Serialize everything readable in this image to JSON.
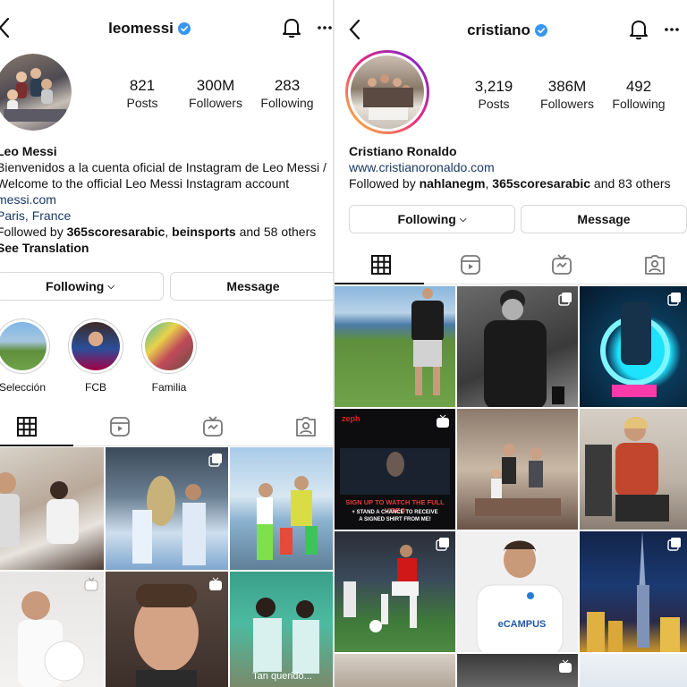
{
  "left": {
    "username": "leomessi",
    "stats": [
      {
        "value": "821",
        "label": "Posts"
      },
      {
        "value": "300M",
        "label": "Followers"
      },
      {
        "value": "283",
        "label": "Following"
      }
    ],
    "bio": {
      "name": "Leo Messi",
      "line1": "Bienvenidos a la cuenta oficial de Instagram de Leo Messi /",
      "line2": "Welcome to the official Leo Messi Instagram account",
      "link": "messi.com",
      "loc_city": "Paris",
      "loc_sep": ", ",
      "loc_country": "France",
      "followed_prefix": "Followed by ",
      "followed_a": "365scoresarabic",
      "followed_sep": ", ",
      "followed_b": "beinsports",
      "followed_suffix": " and 58 others",
      "translation": "See Translation"
    },
    "buttons": {
      "following": "Following",
      "message": "Message"
    },
    "highlights": [
      "Selección",
      "FCB",
      "Familia"
    ],
    "grid_caption": "Tan querido..."
  },
  "right": {
    "username": "cristiano",
    "stats": [
      {
        "value": "3,219",
        "label": "Posts"
      },
      {
        "value": "386M",
        "label": "Followers"
      },
      {
        "value": "492",
        "label": "Following"
      }
    ],
    "bio": {
      "name": "Cristiano Ronaldo",
      "link": "www.cristianoronaldo.com",
      "followed_prefix": "Followed by ",
      "followed_a": "nahlanegm",
      "followed_sep": ", ",
      "followed_b": "365scoresarabic",
      "followed_suffix": " and 83 others"
    },
    "buttons": {
      "following": "Following",
      "message": "Message"
    },
    "grid_texts": {
      "brand": "zeph",
      "headline": "SIGN UP TO WATCH THE FULL VIDEO",
      "sub": "+ STAND A CHANCE TO RECEIVE A SIGNED SHIRT FROM ME!",
      "shirt": "eCAMPUS"
    }
  },
  "colors": {
    "verified": "#3897f0",
    "link": "#1b3a66",
    "story_ring_start": "#f9ce34",
    "story_ring_mid": "#ee2a7b",
    "story_ring_end": "#6228d7"
  }
}
